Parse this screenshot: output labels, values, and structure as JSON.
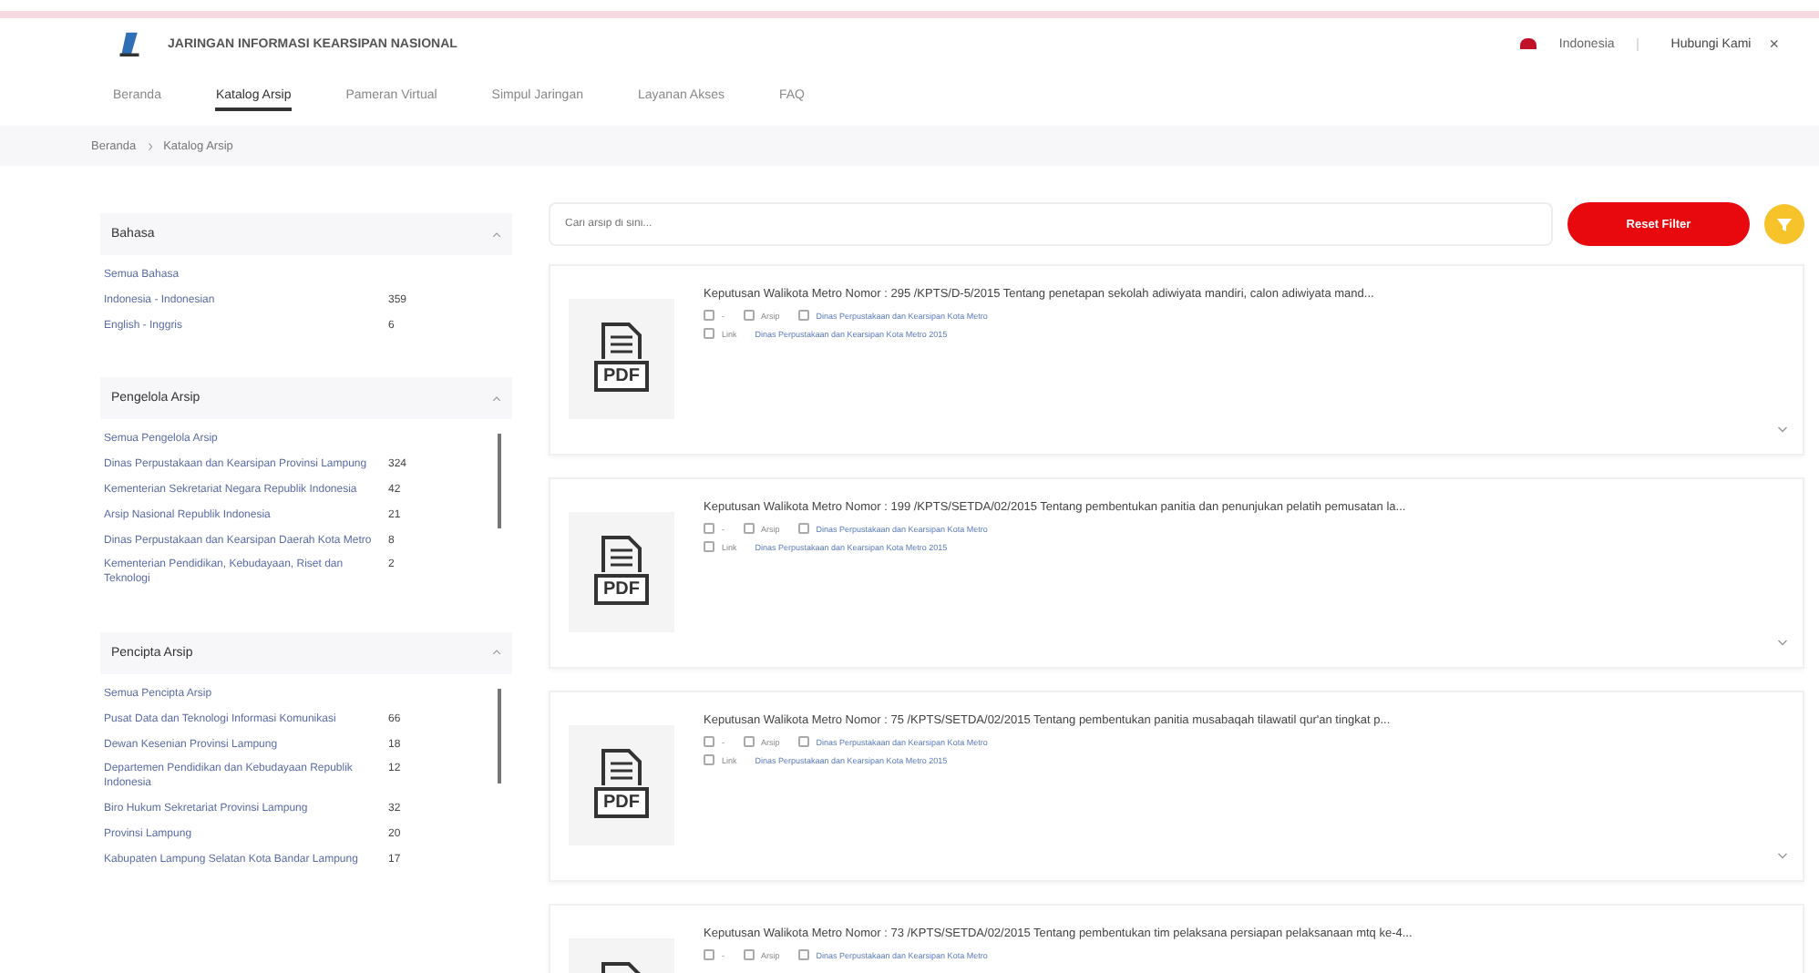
{
  "header": {
    "site_title": "JARINGAN INFORMASI KEARSIPAN NASIONAL",
    "language": "Indonesia",
    "login": "Hubungi Kami",
    "close": "×"
  },
  "tabs": [
    {
      "label": "Beranda",
      "selected": false
    },
    {
      "label": "Katalog Arsip",
      "selected": true
    },
    {
      "label": "Pameran Virtual",
      "selected": false
    },
    {
      "label": "Simpul Jaringan",
      "selected": false
    },
    {
      "label": "Layanan Akses",
      "selected": false
    },
    {
      "label": "FAQ",
      "selected": false
    }
  ],
  "breadcrumb": [
    "Beranda",
    "Katalog Arsip"
  ],
  "filters": [
    {
      "title": "Bahasa",
      "scrollable": false,
      "items": [
        {
          "label": "Semua Bahasa"
        },
        {
          "label": "Indonesia - Indonesian",
          "count": "359"
        },
        {
          "label": "English - Inggris",
          "count": "6"
        }
      ]
    },
    {
      "title": "Pengelola Arsip",
      "scrollable": true,
      "items": [
        {
          "label": "Semua Pengelola Arsip"
        },
        {
          "label": "Dinas Perpustakaan dan Kearsipan Provinsi Lampung",
          "count": "324"
        },
        {
          "label": "Kementerian Sekretariat Negara Republik Indonesia",
          "count": "42"
        },
        {
          "label": "Arsip Nasional Republik Indonesia",
          "count": "21"
        },
        {
          "label": "Dinas Perpustakaan dan Kearsipan Daerah Kota Metro",
          "count": "8"
        },
        {
          "label": "Kementerian Pendidikan, Kebudayaan, Riset dan Teknologi",
          "count": "2"
        }
      ]
    },
    {
      "title": "Pencipta Arsip",
      "scrollable": true,
      "items": [
        {
          "label": "Semua Pencipta Arsip"
        },
        {
          "label": "Pusat Data dan Teknologi Informasi Komunikasi",
          "count": "66"
        },
        {
          "label": "Dewan Kesenian Provinsi Lampung",
          "count": "18"
        },
        {
          "label": "Departemen Pendidikan dan Kebudayaan Republik Indonesia",
          "count": "12"
        },
        {
          "label": "Biro Hukum Sekretariat Provinsi Lampung",
          "count": "32"
        },
        {
          "label": "Provinsi Lampung",
          "count": "20"
        },
        {
          "label": "Kabupaten Lampung Selatan Kota Bandar Lampung",
          "count": "17"
        }
      ]
    }
  ],
  "search": {
    "placeholder": "Cari arsip di sini...",
    "reset": "Reset Filter"
  },
  "results": [
    {
      "badge": "PDF",
      "title": "Keputusan Walikota Metro Nomor : 295 /KPTS/D-5/2015 Tentang penetapan sekolah adiwiyata mandiri, calon adiwiyata mand...",
      "meta": [
        "-",
        "Arsip",
        "Dinas Perpustakaan dan Kearsipan Kota Metro"
      ],
      "link_label": "Link",
      "link": "Dinas Perpustakaan dan Kearsipan Kota Metro 2015"
    },
    {
      "badge": "PDF",
      "title": "Keputusan Walikota Metro Nomor : 199 /KPTS/SETDA/02/2015 Tentang pembentukan panitia dan penunjukan pelatih pemusatan la...",
      "meta": [
        "-",
        "Arsip",
        "Dinas Perpustakaan dan Kearsipan Kota Metro"
      ],
      "link_label": "Link",
      "link": "Dinas Perpustakaan dan Kearsipan Kota Metro 2015"
    },
    {
      "badge": "PDF",
      "title": "Keputusan Walikota Metro Nomor : 75 /KPTS/SETDA/02/2015 Tentang pembentukan panitia musabaqah tilawatil qur'an tingkat p...",
      "meta": [
        "-",
        "Arsip",
        "Dinas Perpustakaan dan Kearsipan Kota Metro"
      ],
      "link_label": "Link",
      "link": "Dinas Perpustakaan dan Kearsipan Kota Metro 2015"
    },
    {
      "title": "Keputusan Walikota Metro Nomor : 73 /KPTS/SETDA/02/2015 Tentang pembentukan tim pelaksana persiapan pelaksanaan mtq ke-4...",
      "meta": [
        "-",
        "Arsip",
        "Dinas Perpustakaan dan Kearsipan Kota Metro"
      ]
    }
  ]
}
